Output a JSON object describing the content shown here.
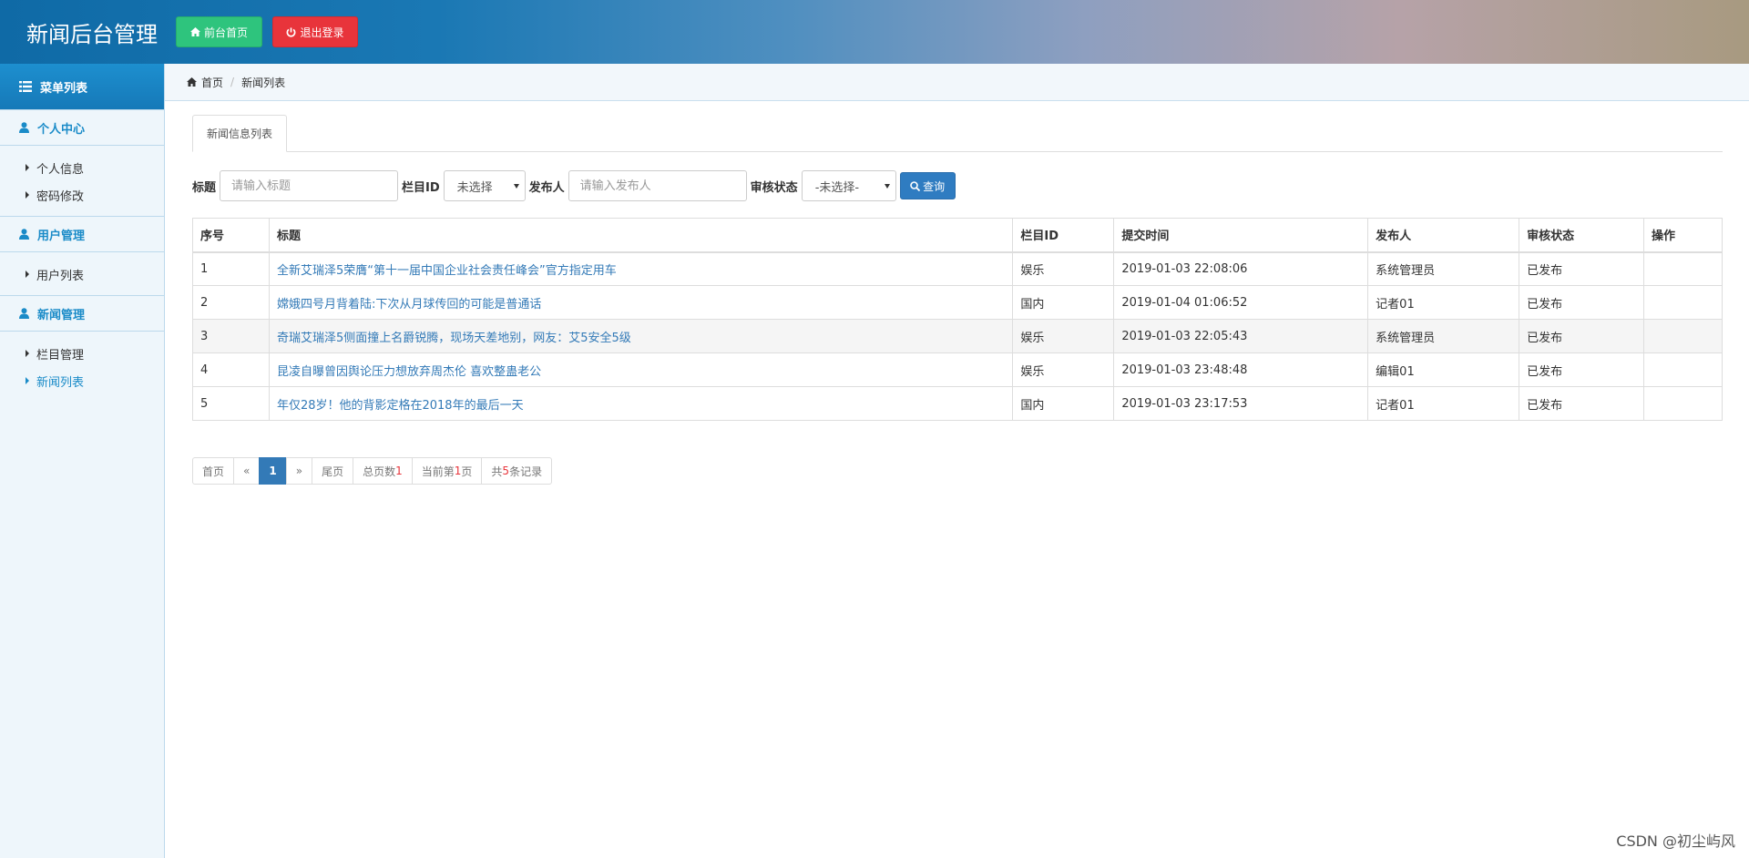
{
  "header": {
    "title": "新闻后台管理",
    "home_button": "前台首页",
    "logout_button": "退出登录",
    "colors": {
      "home": "#2ec47d",
      "logout": "#e8343b"
    }
  },
  "sidebar": {
    "menu_title": "菜单列表",
    "groups": [
      {
        "title": "个人中心",
        "items": [
          "个人信息",
          "密码修改"
        ]
      },
      {
        "title": "用户管理",
        "items": [
          "用户列表"
        ]
      },
      {
        "title": "新闻管理",
        "items": [
          "栏目管理",
          "新闻列表"
        ]
      }
    ]
  },
  "breadcrumb": {
    "home": "首页",
    "current": "新闻列表"
  },
  "tabs": [
    {
      "label": "新闻信息列表"
    }
  ],
  "search": {
    "title_label": "标题",
    "title_placeholder": "请输入标题",
    "column_label": "栏目ID",
    "column_selected": "未选择",
    "publisher_label": "发布人",
    "publisher_placeholder": "请输入发布人",
    "status_label": "审核状态",
    "status_selected": "-未选择-",
    "query_button": "查询"
  },
  "table": {
    "headers": [
      "序号",
      "标题",
      "栏目ID",
      "提交时间",
      "发布人",
      "审核状态",
      "操作"
    ],
    "rows": [
      {
        "no": "1",
        "title": "全新艾瑞泽5荣膺“第十一届中国企业社会责任峰会”官方指定用车",
        "column": "娱乐",
        "time": "2019-01-03 22:08:06",
        "publisher": "系统管理员",
        "status": "已发布",
        "action": ""
      },
      {
        "no": "2",
        "title": "嫦娥四号月背着陆:下次从月球传回的可能是普通话",
        "column": "国内",
        "time": "2019-01-04 01:06:52",
        "publisher": "记者01",
        "status": "已发布",
        "action": ""
      },
      {
        "no": "3",
        "title": "奇瑞艾瑞泽5侧面撞上名爵锐腾，现场天差地别，网友：艾5安全5级",
        "column": "娱乐",
        "time": "2019-01-03 22:05:43",
        "publisher": "系统管理员",
        "status": "已发布",
        "action": ""
      },
      {
        "no": "4",
        "title": "昆凌自曝曾因舆论压力想放弃周杰伦 喜欢整蛊老公",
        "column": "娱乐",
        "time": "2019-01-03 23:48:48",
        "publisher": "编辑01",
        "status": "已发布",
        "action": ""
      },
      {
        "no": "5",
        "title": "年仅28岁！他的背影定格在2018年的最后一天",
        "column": "国内",
        "time": "2019-01-03 23:17:53",
        "publisher": "记者01",
        "status": "已发布",
        "action": ""
      }
    ]
  },
  "pagination": {
    "first": "首页",
    "prev": "«",
    "current": "1",
    "next": "»",
    "last": "尾页",
    "total_pages_prefix": "总页数",
    "total_pages": "1",
    "current_page_prefix": "当前第",
    "current_page": "1",
    "current_page_suffix": "页",
    "records_prefix": "共",
    "records": "5",
    "records_suffix": "条记录"
  },
  "watermark": "CSDN @初尘屿风"
}
